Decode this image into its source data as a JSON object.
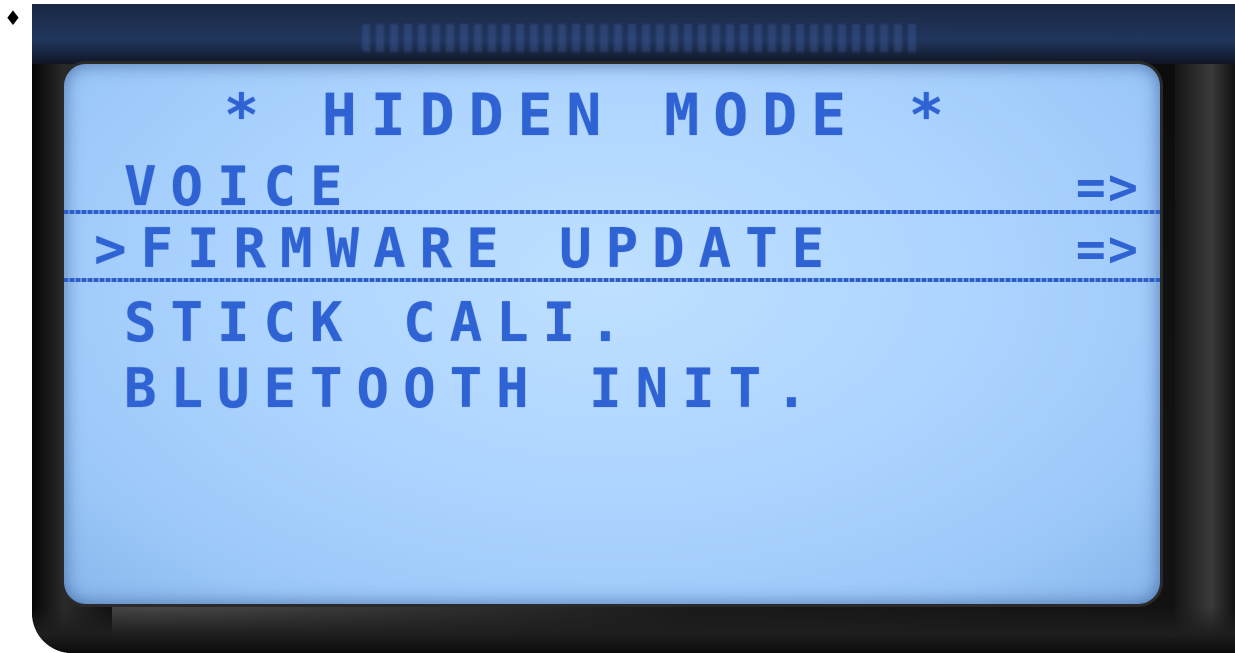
{
  "bullet": "♦",
  "screen": {
    "title": "* HIDDEN MODE *",
    "menu": [
      {
        "label": "VOICE",
        "arrow": "=>",
        "selected": false
      },
      {
        "label": ">FIRMWARE UPDATE",
        "arrow": "=>",
        "selected": true
      },
      {
        "label": "STICK CALI.",
        "arrow": "",
        "selected": false
      },
      {
        "label": "BLUETOOTH INIT.",
        "arrow": "",
        "selected": false
      }
    ]
  },
  "colors": {
    "lcd_background": "#aed5ff",
    "lcd_text": "#2f62d2",
    "bezel": "#111111"
  }
}
